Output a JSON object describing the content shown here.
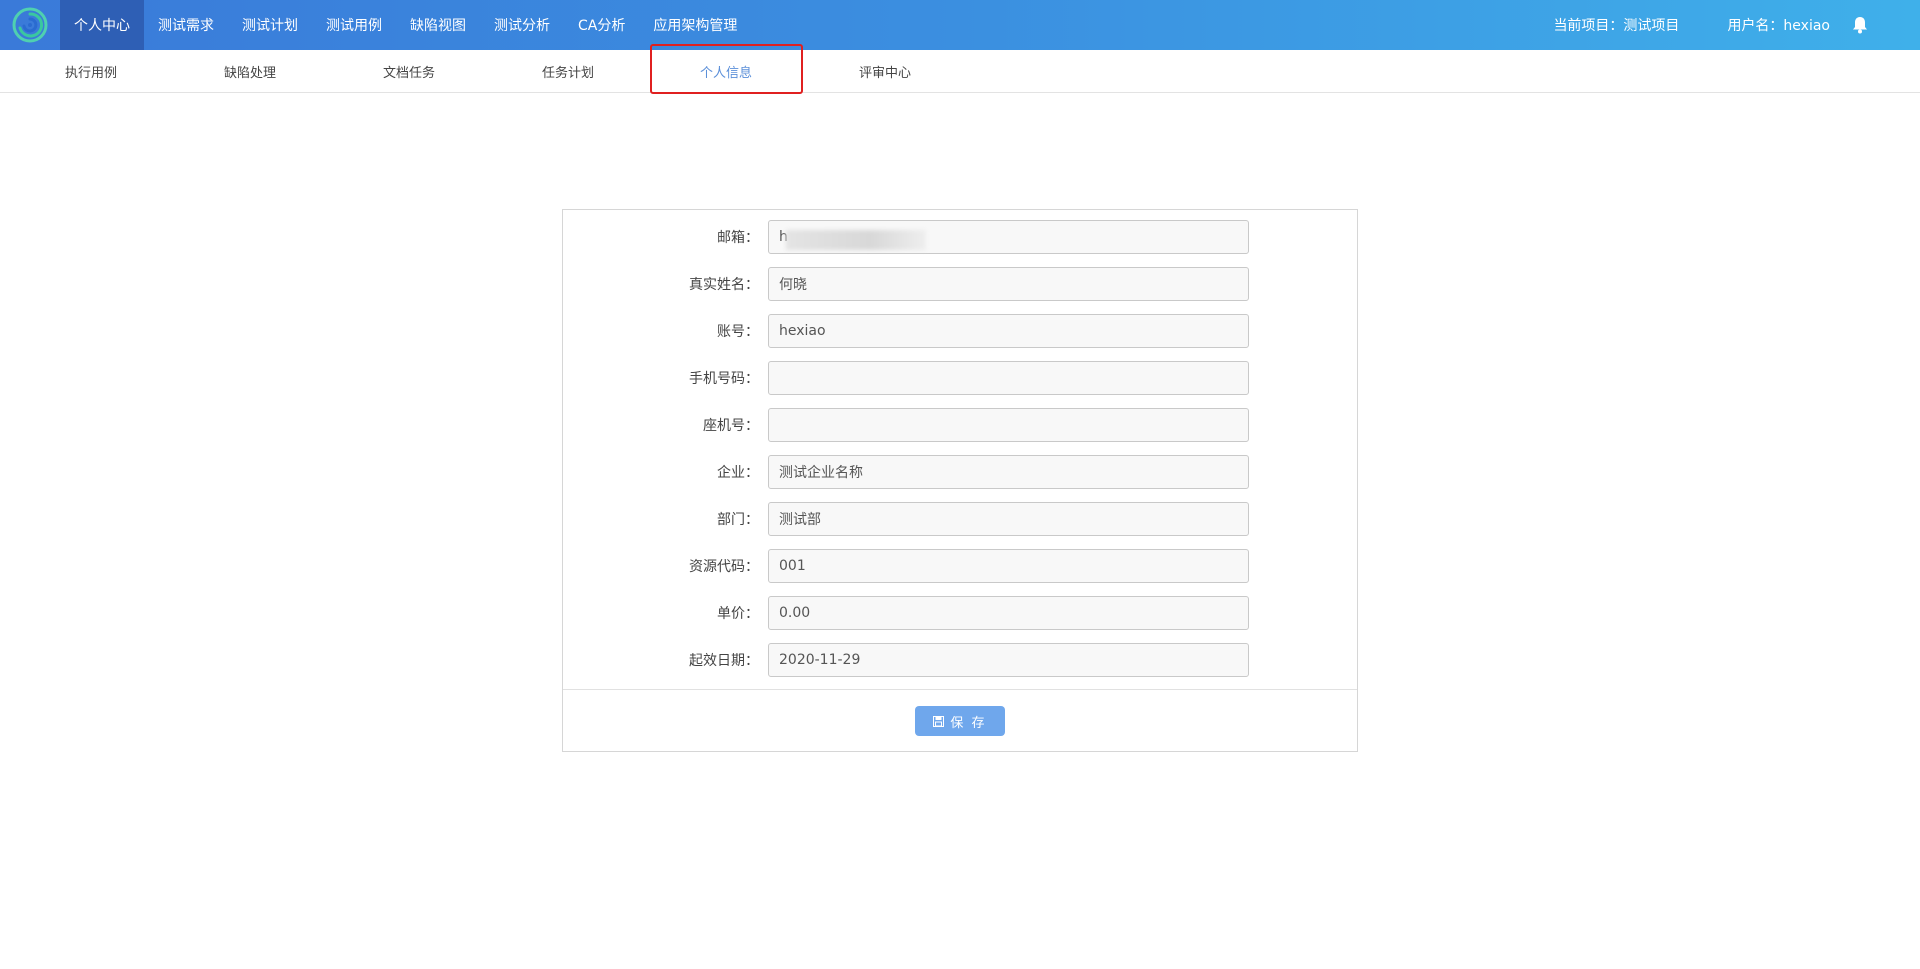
{
  "topnav": {
    "items": [
      "个人中心",
      "测试需求",
      "测试计划",
      "测试用例",
      "缺陷视图",
      "测试分析",
      "CA分析",
      "应用架构管理"
    ],
    "active_index": 0,
    "current_project": "当前项目：测试项目",
    "username": "用户名：hexiao"
  },
  "subnav": {
    "items": [
      "执行用例",
      "缺陷处理",
      "文档任务",
      "任务计划",
      "个人信息",
      "评审中心"
    ],
    "active_index": 4
  },
  "form": {
    "fields": [
      {
        "label": "邮箱：",
        "value": "h"
      },
      {
        "label": "真实姓名：",
        "value": "何晓"
      },
      {
        "label": "账号：",
        "value": "hexiao"
      },
      {
        "label": "手机号码：",
        "value": ""
      },
      {
        "label": "座机号：",
        "value": ""
      },
      {
        "label": "企业：",
        "value": "测试企业名称"
      },
      {
        "label": "部门：",
        "value": "测试部"
      },
      {
        "label": "资源代码：",
        "value": "001"
      },
      {
        "label": "单价：",
        "value": "0.00"
      },
      {
        "label": "起效日期：",
        "value": "2020-11-29"
      }
    ],
    "save_label": "保 存"
  },
  "colors": {
    "accent": "#3a7ad9",
    "active_nav": "#2e5fb5",
    "highlight": "#e02020",
    "button": "#6fa7ec"
  },
  "icons": {
    "logo": "swirl-logo-icon",
    "notification": "bell-icon",
    "save": "floppy-disk-icon"
  }
}
